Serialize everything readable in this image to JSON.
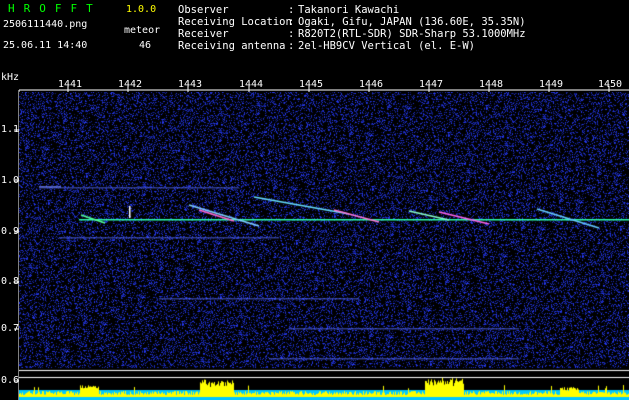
{
  "header": {
    "app_name": "HROFFT",
    "version": "1.0.0",
    "filename": "2506111440.png",
    "meteor_label": "meteor",
    "datetime": "25.06.11 14:40",
    "meteor_count": "46"
  },
  "info": [
    {
      "label": "Observer",
      "value": "Takanori Kawachi"
    },
    {
      "label": "Receiving Location",
      "value": "Ogaki, Gifu, JAPAN (136.60E, 35.35N)"
    },
    {
      "label": "Receiver",
      "value": "R820T2(RTL-SDR) SDR-Sharp 53.1000MHz"
    },
    {
      "label": "Receiving antenna",
      "value": "2el-HB9CV Vertical (el. E-W)"
    }
  ],
  "axes": {
    "freq_unit": "kHz",
    "time_labels": [
      "1441",
      "1442",
      "1443",
      "1444",
      "1445",
      "1446",
      "1447",
      "1448",
      "1449",
      "1450"
    ],
    "freq_labels": [
      "1.1",
      "1.0",
      "0.9",
      "0.8",
      "0.7",
      "0.6"
    ]
  },
  "colors": {
    "background": "#000000",
    "title_green": "#00ff00",
    "version_yellow": "#ffff00",
    "carrier_line": "#00ffaa",
    "noise_blue": "#1a2cff",
    "level_cyan": "#00c8ff",
    "level_yellow": "#ffff00"
  }
}
